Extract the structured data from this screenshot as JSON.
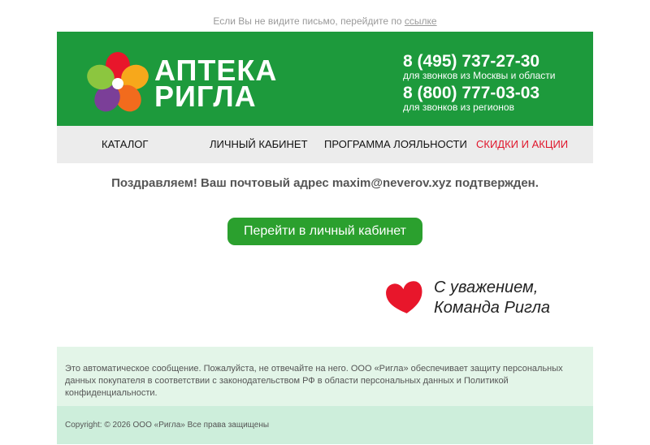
{
  "preheader": {
    "text": "Если Вы не видите письмо, перейдите по",
    "link": "ссылке"
  },
  "header": {
    "brand_line1": "АПТЕКА",
    "brand_line2": "РИГЛА",
    "phone1": "8 (495) 737-27-30",
    "phone1_note": "для звонков из Москвы и области",
    "phone2": "8 (800) 777-03-03",
    "phone2_note": "для звонков из регионов",
    "bg_color": "#1d9a3c"
  },
  "nav": {
    "items": [
      {
        "label": "КАТАЛОГ"
      },
      {
        "label": "ЛИЧНЫЙ КАБИНЕТ"
      },
      {
        "label": "ПРОГРАММА ЛОЯЛЬНОСТИ"
      },
      {
        "label": "СКИДКИ И АКЦИИ"
      }
    ],
    "sale_color": "#e0162b"
  },
  "message": "Поздравляем! Ваш почтовый адрес maxim@neverov.xyz подтвержден.",
  "cta_label": "Перейти в личный кабинет",
  "signature": {
    "line1": "С уважением,",
    "line2": "Команда Ригла"
  },
  "footer": {
    "notice": "Это автоматическое сообщение. Пожалуйста, не отвечайте на него. ООО «Ригла» обеспечивает защиту персональных данных покупателя в соответствии с законодательством РФ в области персональных данных и Политикой конфиденциальности.",
    "copyright": "Copyright: © 2026 ООО «Ригла» Все права защищены"
  }
}
